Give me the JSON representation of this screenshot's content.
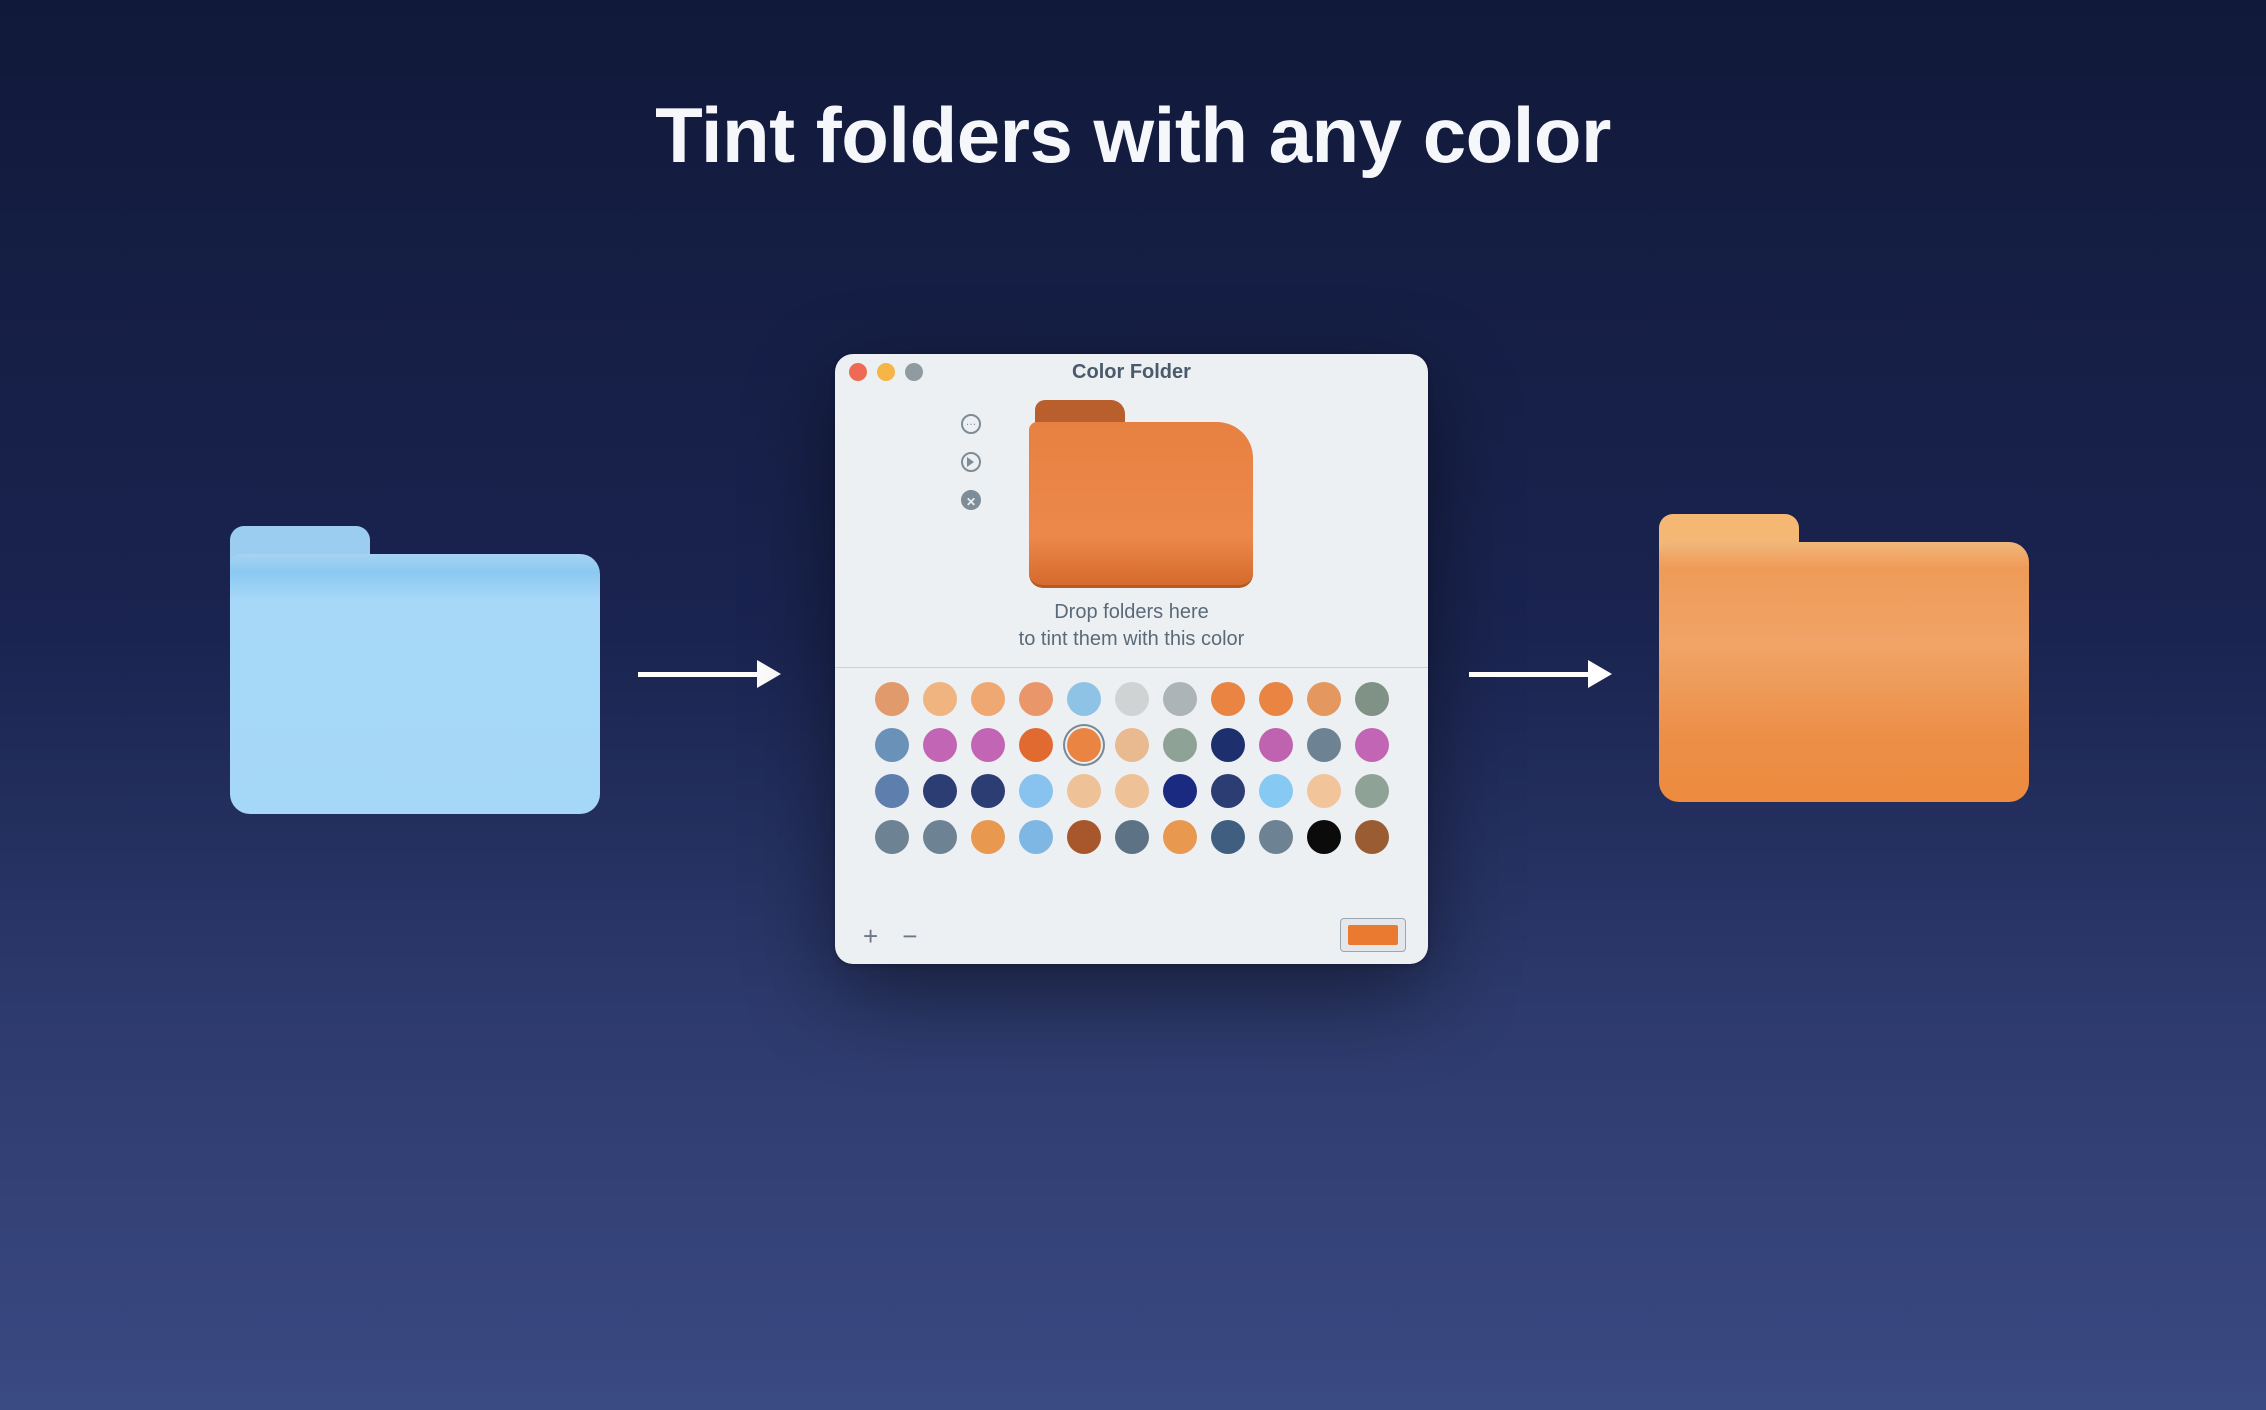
{
  "headline": "Tint folders with any color",
  "source_folder_color": "#a5d7f7",
  "result_folder_color": "#ef9a55",
  "app": {
    "window_title": "Color Folder",
    "traffic_lights": {
      "close": "#ef6a54",
      "minimize": "#f5b547",
      "zoom_disabled": "#8f9ba0"
    },
    "side_tools": [
      "more",
      "export",
      "clear"
    ],
    "preview_tint": "#e78142",
    "drop_hint_line1": "Drop folders here",
    "drop_hint_line2": "to tint them with this color",
    "swatches": [
      [
        "#e19a6b",
        "#f0b481",
        "#f0a873",
        "#e9976a",
        "#8fc3e6",
        "#cfd3d4",
        "#adb4b7",
        "#ea8442",
        "#ea8442",
        "#e4975f",
        "#7f9285"
      ],
      [
        "#6a91b7",
        "#c265b4",
        "#c265b4",
        "#e06a2f",
        "#ea8442",
        "#e9b98f",
        "#8ea295",
        "#1e2f6e",
        "#bf63b0",
        "#6d8393",
        "#c265b4"
      ],
      [
        "#5e7fae",
        "#2c3d74",
        "#2c3d74",
        "#87c3ee",
        "#eec196",
        "#eec196",
        "#1a2a80",
        "#2c3d74",
        "#86c9f2",
        "#f2c49a",
        "#8ea295"
      ],
      [
        "#6d8393",
        "#6d8393",
        "#e8984f",
        "#7fb7e4",
        "#a8572c",
        "#5d7285",
        "#e8984f",
        "#3f5e80",
        "#6d8393",
        "#0b0b0b",
        "#9a5c33"
      ]
    ],
    "selected_swatch": {
      "row": 1,
      "col": 4
    },
    "add_label": "+",
    "remove_label": "−",
    "color_well": "#ea7a30"
  }
}
